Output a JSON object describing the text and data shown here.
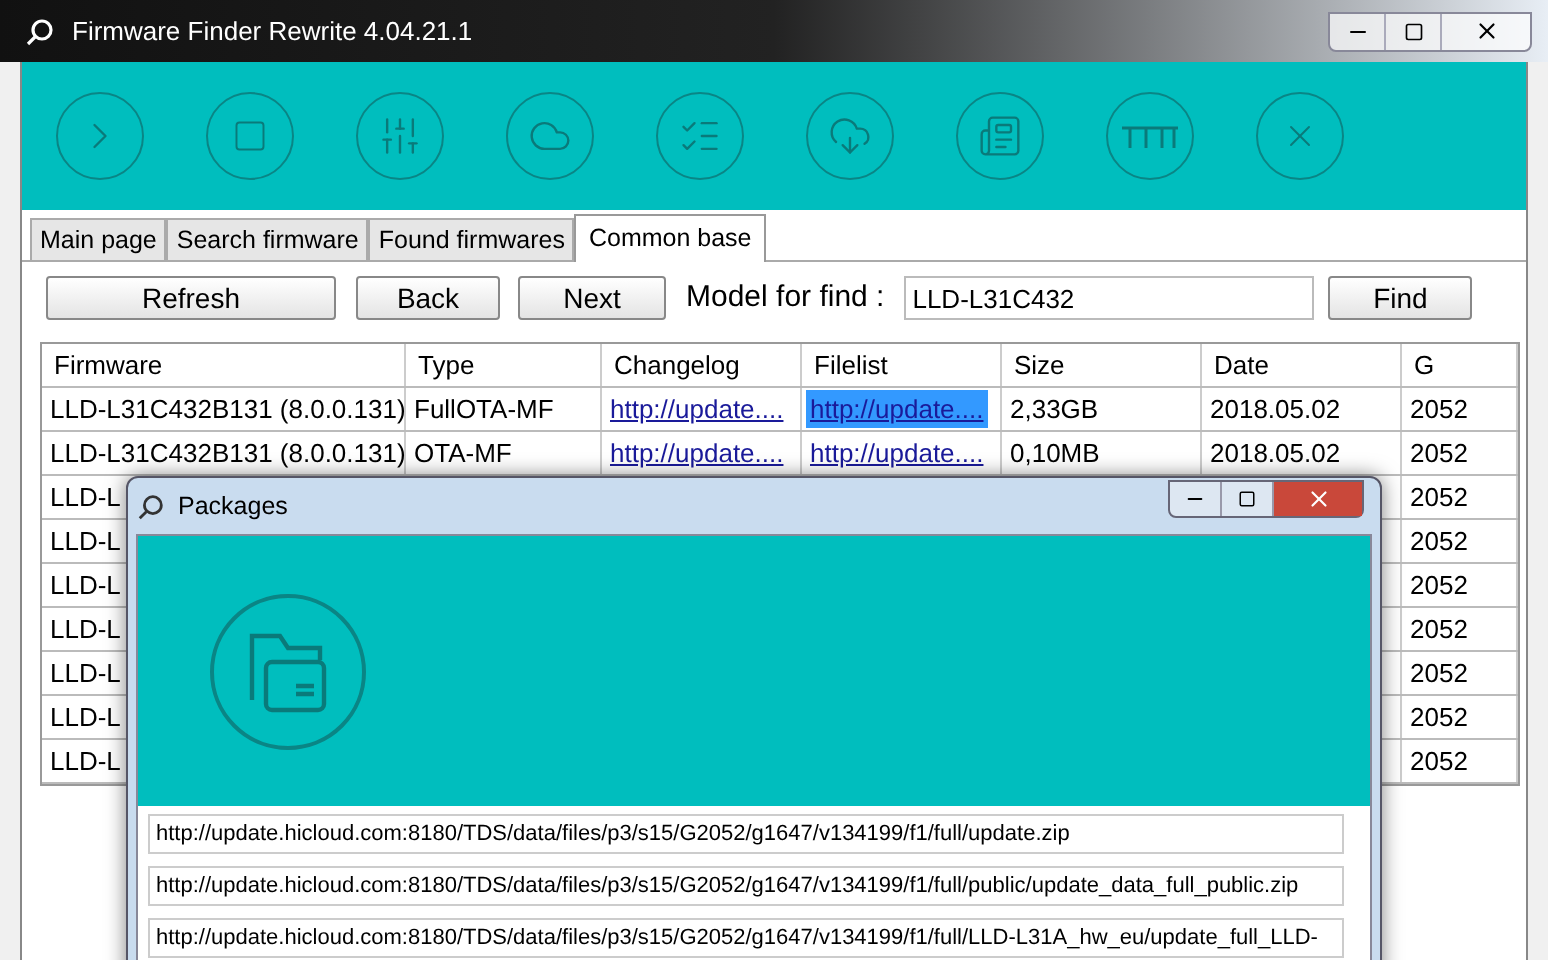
{
  "window": {
    "title": "Firmware Finder Rewrite 4.04.21.1"
  },
  "toolbar": [
    {
      "kind": "start"
    },
    {
      "kind": "stop"
    },
    {
      "kind": "settings"
    },
    {
      "kind": "cloud-doc"
    },
    {
      "kind": "checklist"
    },
    {
      "kind": "download"
    },
    {
      "kind": "news"
    },
    {
      "kind": "rail"
    },
    {
      "kind": "close"
    }
  ],
  "tabs": [
    {
      "label": "Main page",
      "selected": false
    },
    {
      "label": "Search firmware",
      "selected": false
    },
    {
      "label": "Found firmwares",
      "selected": false
    },
    {
      "label": "Common base",
      "selected": true
    }
  ],
  "actions": {
    "refresh": "Refresh",
    "back": "Back",
    "next": "Next",
    "model_label": "Model for find :",
    "model_value": "LLD-L31C432",
    "find": "Find"
  },
  "table": {
    "columns": [
      "Firmware",
      "Type",
      "Changelog",
      "Filelist",
      "Size",
      "Date",
      "G"
    ],
    "rows": [
      {
        "firmware": "LLD-L31C432B131 (8.0.0.131)",
        "type": "FullOTA-MF",
        "changelog": "http://update....",
        "filelist": "http://update....",
        "filelist_selected": true,
        "size": "2,33GB",
        "date": "2018.05.02",
        "g": "2052"
      },
      {
        "firmware": "LLD-L31C432B131 (8.0.0.131)",
        "type": "OTA-MF",
        "changelog": "http://update....",
        "filelist": "http://update....",
        "filelist_selected": false,
        "size": "0,10MB",
        "date": "2018.05.02",
        "g": "2052"
      },
      {
        "firmware": "LLD-L",
        "g": "2052"
      },
      {
        "firmware": "LLD-L",
        "g": "2052"
      },
      {
        "firmware": "LLD-L",
        "g": "2052"
      },
      {
        "firmware": "LLD-L",
        "g": "2052"
      },
      {
        "firmware": "LLD-L",
        "g": "2052"
      },
      {
        "firmware": "LLD-L",
        "g": "2052"
      },
      {
        "firmware": "LLD-L",
        "g": "2052"
      }
    ]
  },
  "dialog": {
    "title": "Packages",
    "urls": [
      "http://update.hicloud.com:8180/TDS/data/files/p3/s15/G2052/g1647/v134199/f1/full/update.zip",
      "http://update.hicloud.com:8180/TDS/data/files/p3/s15/G2052/g1647/v134199/f1/full/public/update_data_full_public.zip",
      "http://update.hicloud.com:8180/TDS/data/files/p3/s15/G2052/g1647/v134199/f1/full/LLD-L31A_hw_eu/update_full_LLD-"
    ]
  }
}
